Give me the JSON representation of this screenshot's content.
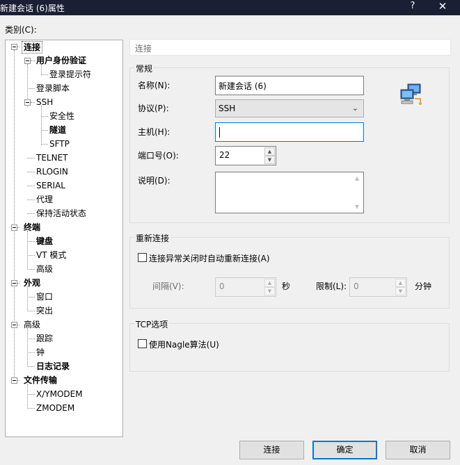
{
  "window": {
    "title": "新建会话 (6)属性",
    "help": "?",
    "close": "✕"
  },
  "category_label": "类别(C):",
  "tree": {
    "items": [
      {
        "label": "连接",
        "bold": true,
        "selected": true
      },
      {
        "label": "用户身份验证",
        "bold": true
      },
      {
        "label": "登录提示符"
      },
      {
        "label": "登录脚本"
      },
      {
        "label": "SSH"
      },
      {
        "label": "安全性"
      },
      {
        "label": "隧道",
        "bold": true
      },
      {
        "label": "SFTP"
      },
      {
        "label": "TELNET"
      },
      {
        "label": "RLOGIN"
      },
      {
        "label": "SERIAL"
      },
      {
        "label": "代理"
      },
      {
        "label": "保持活动状态"
      },
      {
        "label": "终端",
        "bold": true
      },
      {
        "label": "键盘",
        "bold": true
      },
      {
        "label": "VT 模式"
      },
      {
        "label": "高级"
      },
      {
        "label": "外观",
        "bold": true
      },
      {
        "label": "窗口"
      },
      {
        "label": "突出"
      },
      {
        "label": "高级"
      },
      {
        "label": "跟踪"
      },
      {
        "label": "钟"
      },
      {
        "label": "日志记录",
        "bold": true
      },
      {
        "label": "文件传输",
        "bold": true
      },
      {
        "label": "X/YMODEM"
      },
      {
        "label": "ZMODEM"
      }
    ]
  },
  "page_header": "连接",
  "general": {
    "title": "常规",
    "name_label": "名称(N):",
    "name_value": "新建会话 (6)",
    "protocol_label": "协议(P):",
    "protocol_value": "SSH",
    "host_label": "主机(H):",
    "host_value": "",
    "port_label": "端口号(O):",
    "port_value": "22",
    "desc_label": "说明(D):",
    "desc_value": "",
    "icon": "network-computers-icon"
  },
  "reconnect": {
    "title": "重新连接",
    "auto_label": "连接异常关闭时自动重新连接(A)",
    "interval_label": "间隔(V):",
    "interval_value": "0",
    "interval_unit": "秒",
    "limit_label": "限制(L):",
    "limit_value": "0",
    "limit_unit": "分钟"
  },
  "tcp": {
    "title": "TCP选项",
    "nagle_label": "使用Nagle算法(U)"
  },
  "buttons": {
    "connect": "连接",
    "ok": "确定",
    "cancel": "取消"
  }
}
